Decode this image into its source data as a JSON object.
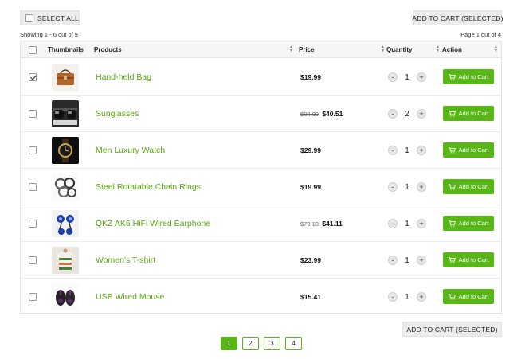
{
  "toolbar": {
    "select_all_label": "SELECT ALL",
    "add_selected_label": "ADD TO CART (SELECTED)"
  },
  "meta": {
    "showing": "Showing 1 - 6 out of 9",
    "page_of": "Page 1 out of 4"
  },
  "table": {
    "headers": {
      "thumbnails": "Thumbnails",
      "products": "Products",
      "price": "Price",
      "quantity": "Quantity",
      "action": "Action"
    },
    "rows": [
      {
        "name": "Hand-held Bag",
        "old_price": "",
        "price": "$19.99",
        "qty": "1",
        "checked": true,
        "thumb": "bag"
      },
      {
        "name": "Sunglasses",
        "old_price": "$80.00",
        "price": "$40.51",
        "qty": "2",
        "checked": false,
        "thumb": "sunglasses"
      },
      {
        "name": "Men Luxury Watch",
        "old_price": "",
        "price": "$29.99",
        "qty": "1",
        "checked": false,
        "thumb": "watch"
      },
      {
        "name": "Steel Rotatable Chain Rings",
        "old_price": "",
        "price": "$19.99",
        "qty": "1",
        "checked": false,
        "thumb": "rings"
      },
      {
        "name": "QKZ AK6 HiFi Wired Earphone",
        "old_price": "$70.13",
        "price": "$41.11",
        "qty": "1",
        "checked": false,
        "thumb": "earphone"
      },
      {
        "name": "Women's T-shirt",
        "old_price": "",
        "price": "$23.99",
        "qty": "1",
        "checked": false,
        "thumb": "tshirt"
      },
      {
        "name": "USB Wired Mouse",
        "old_price": "",
        "price": "$15.41",
        "qty": "1",
        "checked": false,
        "thumb": "mouse"
      }
    ],
    "add_to_cart_label": "Add to Cart",
    "minus_label": "-",
    "plus_label": "+"
  },
  "pagination": {
    "pages": [
      "1",
      "2",
      "3",
      "4"
    ],
    "active": "1"
  },
  "colors": {
    "accent_green": "#58b616",
    "link_green": "#5aa812",
    "button_gray": "#ececec"
  }
}
